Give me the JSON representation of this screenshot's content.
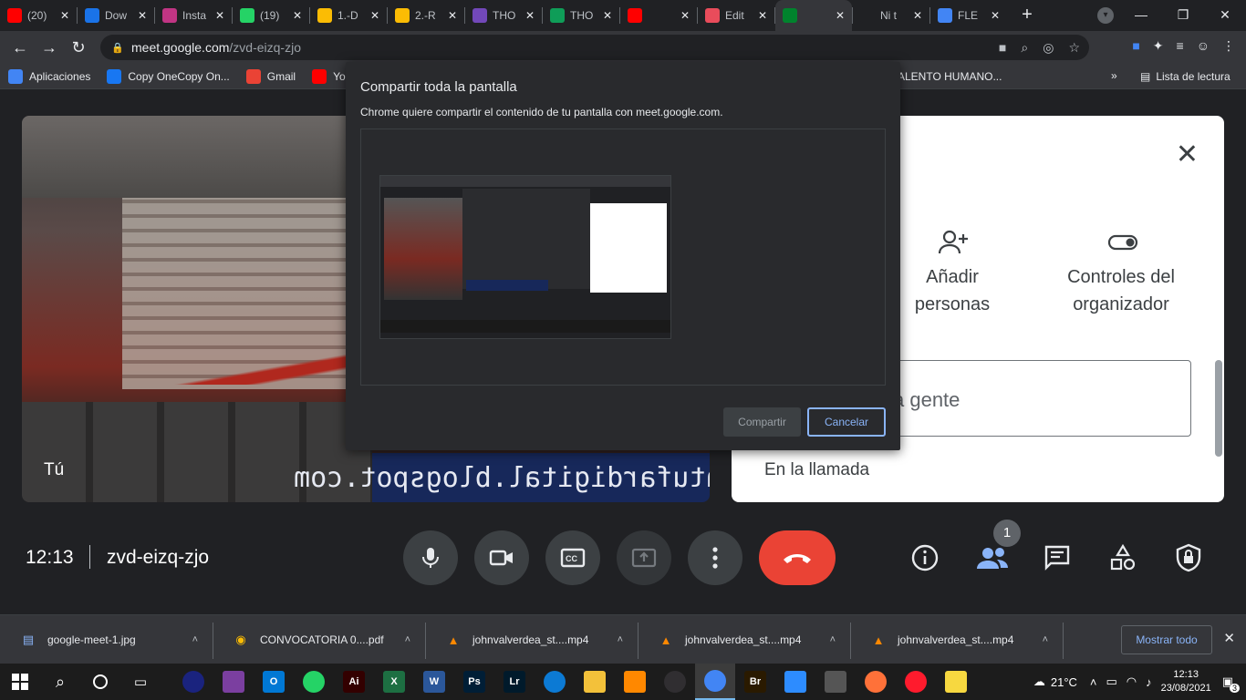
{
  "browser": {
    "tabs": [
      {
        "label": "(20)",
        "color": "#ff0000"
      },
      {
        "label": "Dow",
        "color": "#1a73e8"
      },
      {
        "label": "Insta",
        "color": "#c13584"
      },
      {
        "label": "(19)",
        "color": "#25d366"
      },
      {
        "label": "1.-D",
        "color": "#fbbc04"
      },
      {
        "label": "2.-R",
        "color": "#fbbc04"
      },
      {
        "label": "THO",
        "color": "#7248b9"
      },
      {
        "label": "THO",
        "color": "#0f9d58"
      },
      {
        "label": "",
        "color": "#ff0000"
      },
      {
        "label": "Edit",
        "color": "#e94c5b"
      },
      {
        "label": "",
        "color": "#00832d"
      },
      {
        "label": "Ni t",
        "color": "#202124"
      },
      {
        "label": "FLE",
        "color": "#4285f4"
      }
    ],
    "url_host": "meet.google.com",
    "url_path": "/zvd-eizq-zjo",
    "bookmarks": [
      {
        "label": "Aplicaciones",
        "color": "#4285f4"
      },
      {
        "label": "Copy OneCopy On...",
        "color": "#1877f2"
      },
      {
        "label": "Gmail",
        "color": "#ea4335"
      },
      {
        "label": "Yo",
        "color": "#ff0000"
      }
    ],
    "bookmark_hidden": "ALENTO HUMANO...",
    "reading_list": "Lista de lectura"
  },
  "meet": {
    "self_label": "Tú",
    "blog_text": "uemontufardigital.blogspot.com",
    "panel": {
      "add_people": [
        "Añadir",
        "personas"
      ],
      "host_controls": [
        "Controles del",
        "organizador"
      ],
      "search_placeholder": "a gente",
      "in_call": "En la llamada"
    },
    "time": "12:13",
    "meeting_code": "zvd-eizq-zjo",
    "participant_count": "1"
  },
  "dialog": {
    "title": "Compartir toda la pantalla",
    "subtitle": "Chrome quiere compartir el contenido de tu pantalla con meet.google.com.",
    "share_label": "Compartir",
    "cancel_label": "Cancelar"
  },
  "downloads": {
    "items": [
      {
        "name": "google-meet-1.jpg",
        "icon": "image-file-icon"
      },
      {
        "name": "CONVOCATORIA 0....pdf",
        "icon": "chrome-icon"
      },
      {
        "name": "johnvalverdea_st....mp4",
        "icon": "vlc-icon"
      },
      {
        "name": "johnvalverdea_st....mp4",
        "icon": "vlc-icon"
      },
      {
        "name": "johnvalverdea_st....mp4",
        "icon": "vlc-icon"
      }
    ],
    "show_all": "Mostrar todo"
  },
  "taskbar": {
    "apps": [
      {
        "name": "firefox-dev",
        "label": "",
        "color": "#1a237e"
      },
      {
        "name": "winrar",
        "label": "",
        "color": "#7b3fa0"
      },
      {
        "name": "outlook",
        "label": "O",
        "color": "#0078d4"
      },
      {
        "name": "whatsapp",
        "label": "",
        "color": "#25d366"
      },
      {
        "name": "illustrator",
        "label": "Ai",
        "color": "#330000"
      },
      {
        "name": "excel",
        "label": "X",
        "color": "#1d6f42"
      },
      {
        "name": "word",
        "label": "W",
        "color": "#2b579a"
      },
      {
        "name": "photoshop",
        "label": "Ps",
        "color": "#001e36"
      },
      {
        "name": "lightroom",
        "label": "Lr",
        "color": "#001a2b"
      },
      {
        "name": "edge",
        "label": "",
        "color": "#0c7ad4"
      },
      {
        "name": "explorer",
        "label": "",
        "color": "#f3c13a"
      },
      {
        "name": "vlc",
        "label": "",
        "color": "#ff8800"
      },
      {
        "name": "obs",
        "label": "",
        "color": "#302e31"
      },
      {
        "name": "chrome",
        "label": "",
        "color": "#4285f4"
      },
      {
        "name": "bridge",
        "label": "Br",
        "color": "#2a1a00"
      },
      {
        "name": "zoom",
        "label": "",
        "color": "#2d8cff"
      },
      {
        "name": "calculator",
        "label": "",
        "color": "#555"
      },
      {
        "name": "firefox",
        "label": "",
        "color": "#ff7139"
      },
      {
        "name": "opera",
        "label": "",
        "color": "#ff1b2d"
      },
      {
        "name": "sticky",
        "label": "",
        "color": "#f7d840"
      }
    ],
    "temperature": "21°C",
    "time": "12:13",
    "date": "23/08/2021",
    "notifications": "3"
  }
}
